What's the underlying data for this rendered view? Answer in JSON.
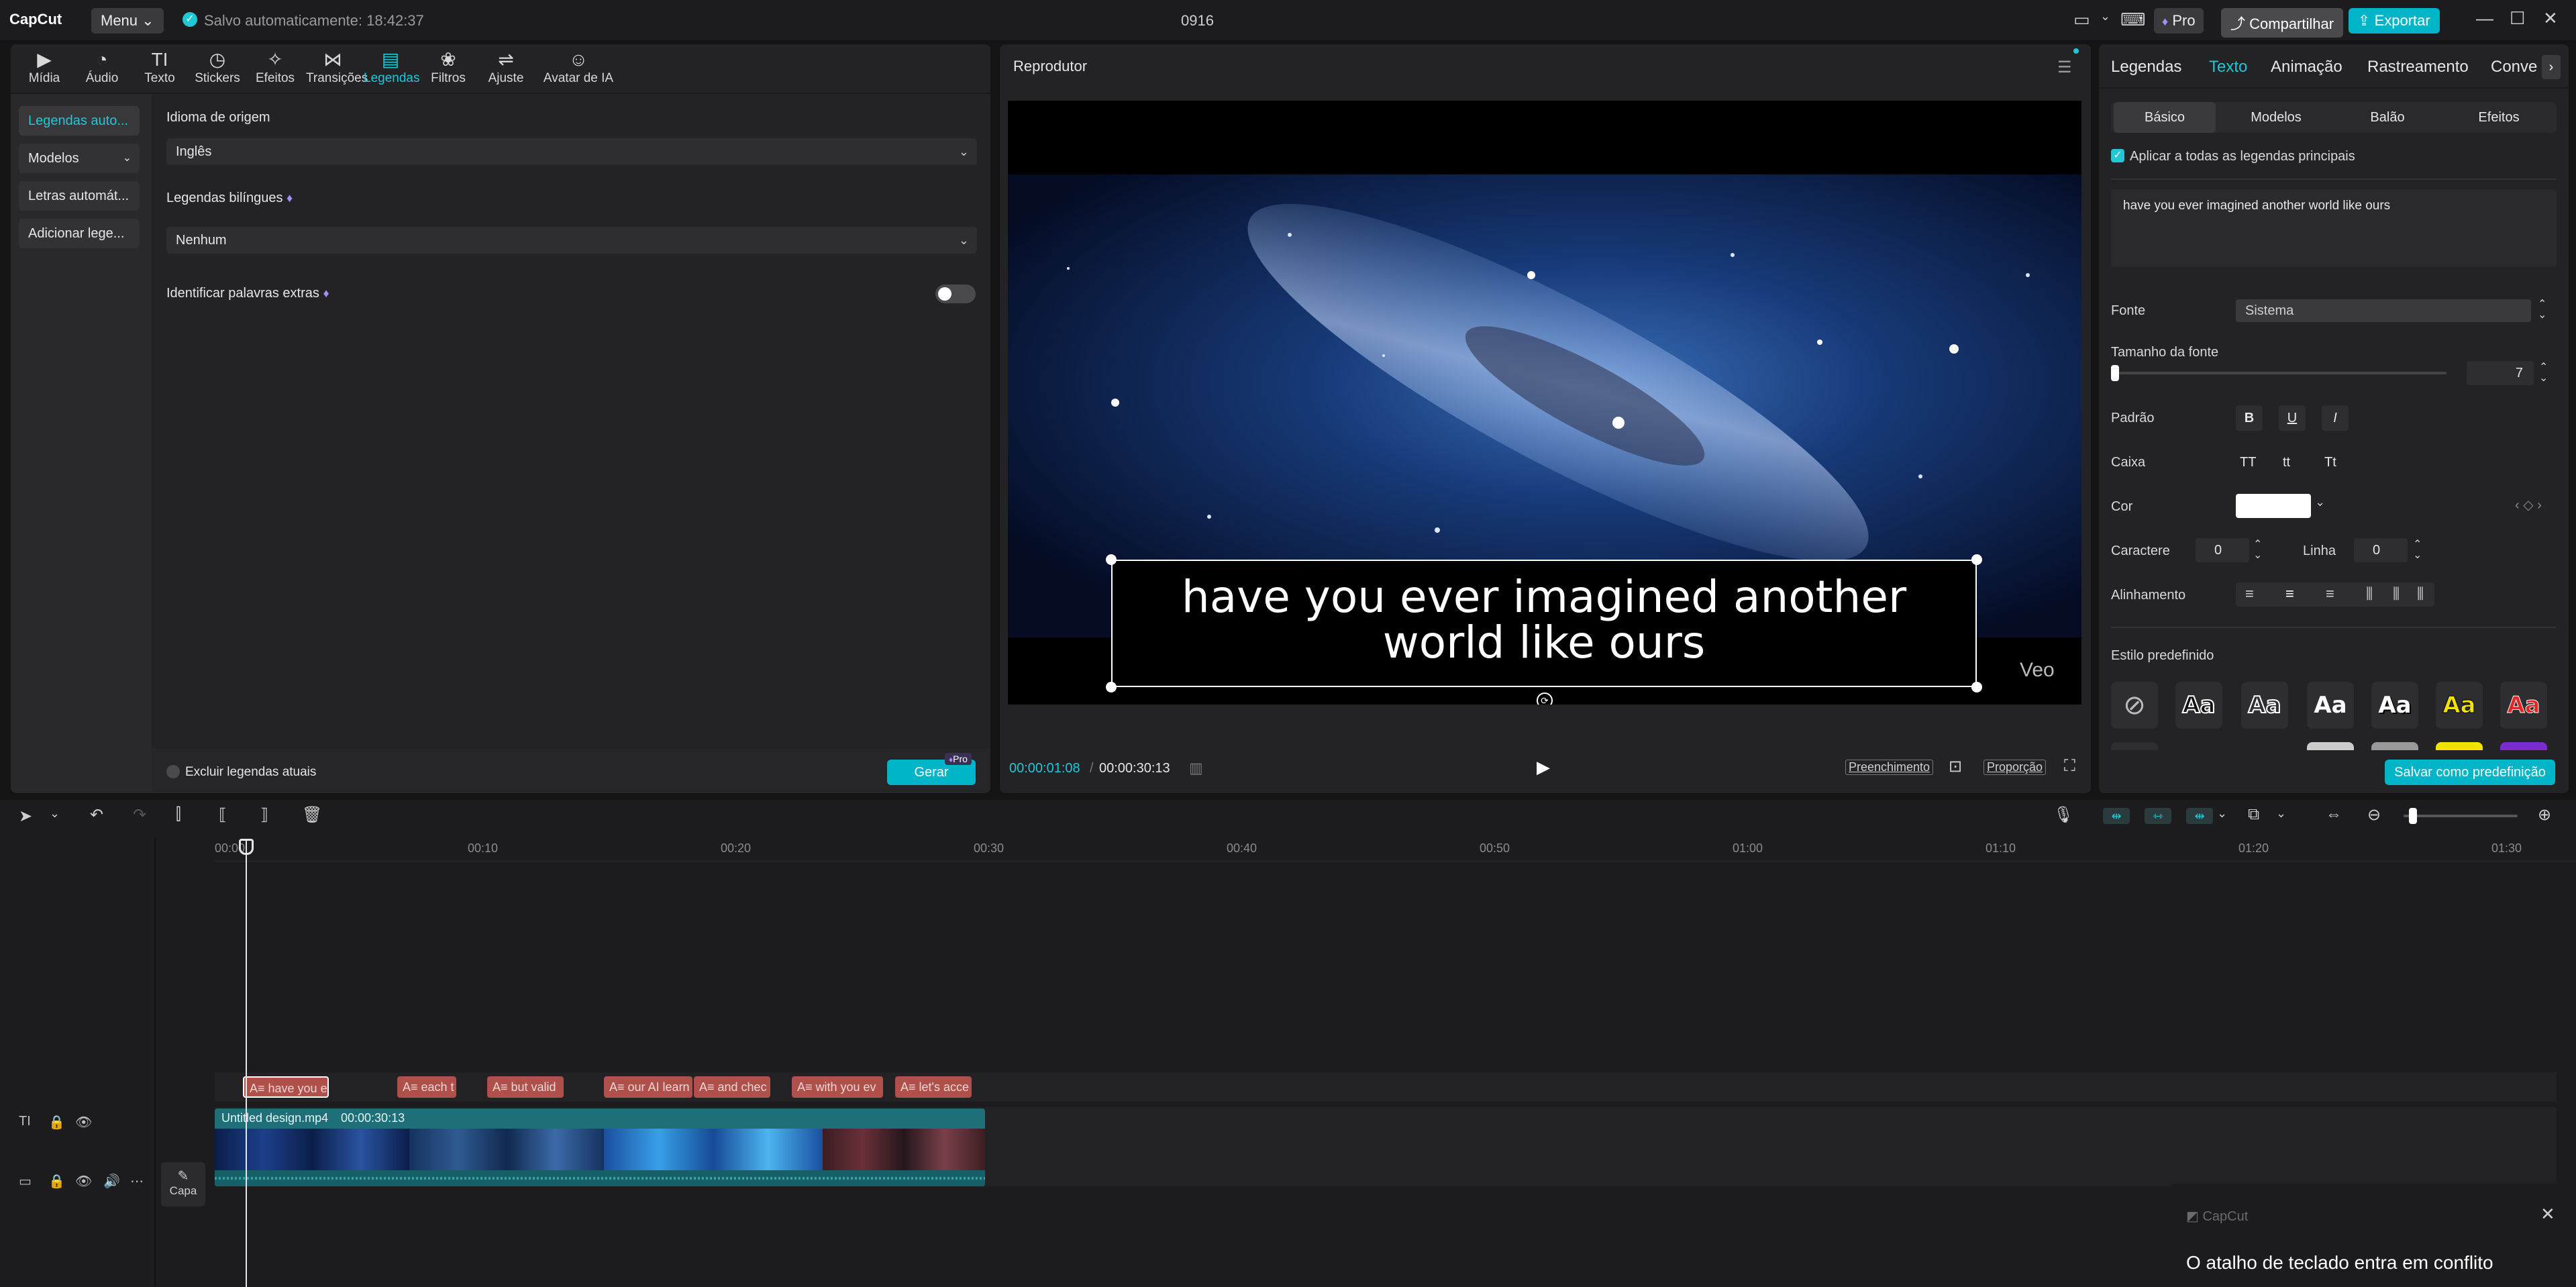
{
  "app": {
    "logo": "CapCut",
    "menu_label": "Menu",
    "autosave_text": "Salvo automaticamente: 18:42:37",
    "project_title": "0916",
    "pro_label": "Pro",
    "share_label": "Compartilhar",
    "export_label": "Exportar"
  },
  "toolbar": {
    "tools": [
      {
        "label": "Mídia",
        "icon": "media-icon"
      },
      {
        "label": "Áudio",
        "icon": "audio-icon"
      },
      {
        "label": "Texto",
        "icon": "text-icon"
      },
      {
        "label": "Stickers",
        "icon": "stickers-icon"
      },
      {
        "label": "Efeitos",
        "icon": "effects-icon"
      },
      {
        "label": "Transições",
        "icon": "transitions-icon"
      },
      {
        "label": "Legendas",
        "icon": "captions-icon"
      },
      {
        "label": "Filtros",
        "icon": "filters-icon"
      },
      {
        "label": "Ajuste",
        "icon": "adjust-icon"
      },
      {
        "label": "Avatar de IA",
        "icon": "ai-avatar-icon"
      }
    ],
    "active": "Legendas"
  },
  "left_sidebar": {
    "items": [
      "Legendas auto...",
      "Modelos",
      "Letras automát...",
      "Adicionar lege..."
    ]
  },
  "captions_panel": {
    "source_language_label": "Idioma de origem",
    "source_language_value": "Inglês",
    "bilingual_label": "Legendas bilíngues",
    "bilingual_value": "Nenhum",
    "identify_extra_words_label": "Identificar palavras extras",
    "exclude_current_label": "Excluir legendas atuais",
    "generate_label": "Gerar",
    "generate_badge": "Pro"
  },
  "player": {
    "title": "Reprodutor",
    "subtitle_text": "have you ever imagined another world like ours",
    "watermark": "Veo",
    "current_time": "00:00:01:08",
    "total_time": "00:00:30:13",
    "fill_label": "Preenchimento",
    "ratio_label": "Proporção"
  },
  "right_panel": {
    "tabs": [
      "Legendas",
      "Texto",
      "Animação",
      "Rastreamento",
      "Conve"
    ],
    "active_tab": "Texto",
    "subtabs": [
      "Básico",
      "Modelos",
      "Balão",
      "Efeitos"
    ],
    "active_subtab": "Básico",
    "apply_all_label": "Aplicar a todas as legendas principais",
    "text_value": "have you ever imagined another world like ours",
    "font_label": "Fonte",
    "font_value": "Sistema",
    "font_size_label": "Tamanho da fonte",
    "font_size_value": "7",
    "pattern_label": "Padrão",
    "pattern_buttons": [
      "B",
      "U",
      "I"
    ],
    "case_label": "Caixa",
    "case_buttons": [
      "TT",
      "tt",
      "Tt"
    ],
    "color_label": "Cor",
    "character_label": "Caractere",
    "character_value": "0",
    "line_label": "Linha",
    "line_value": "0",
    "alignment_label": "Alinhamento",
    "preset_style_label": "Estilo predefinido",
    "presets": [
      "Aa",
      "Aa",
      "Aa",
      "Aa",
      "Aa",
      "Aa"
    ],
    "save_preset_label": "Salvar como predefinição"
  },
  "timeline": {
    "ticks": [
      "00:00",
      "00:10",
      "00:20",
      "00:30",
      "00:40",
      "00:50",
      "01:00",
      "01:10",
      "01:20",
      "01:30"
    ],
    "subtitle_clips": [
      "have you e",
      "each t",
      "but valid",
      "our AI learn",
      "and chec",
      "with you ev",
      "let's acce"
    ],
    "video_clip_name": "Untitled design.mp4",
    "video_clip_duration": "00:00:30:13",
    "cover_label": "Capa"
  },
  "notification": {
    "app_name": "CapCut",
    "message": "O atalho de teclado entra em conflito"
  },
  "colors": {
    "accent": "#22c7d6",
    "export": "#00b5c8",
    "subtitle_clip": "#b0504a",
    "video_clip": "#1f6f78"
  }
}
